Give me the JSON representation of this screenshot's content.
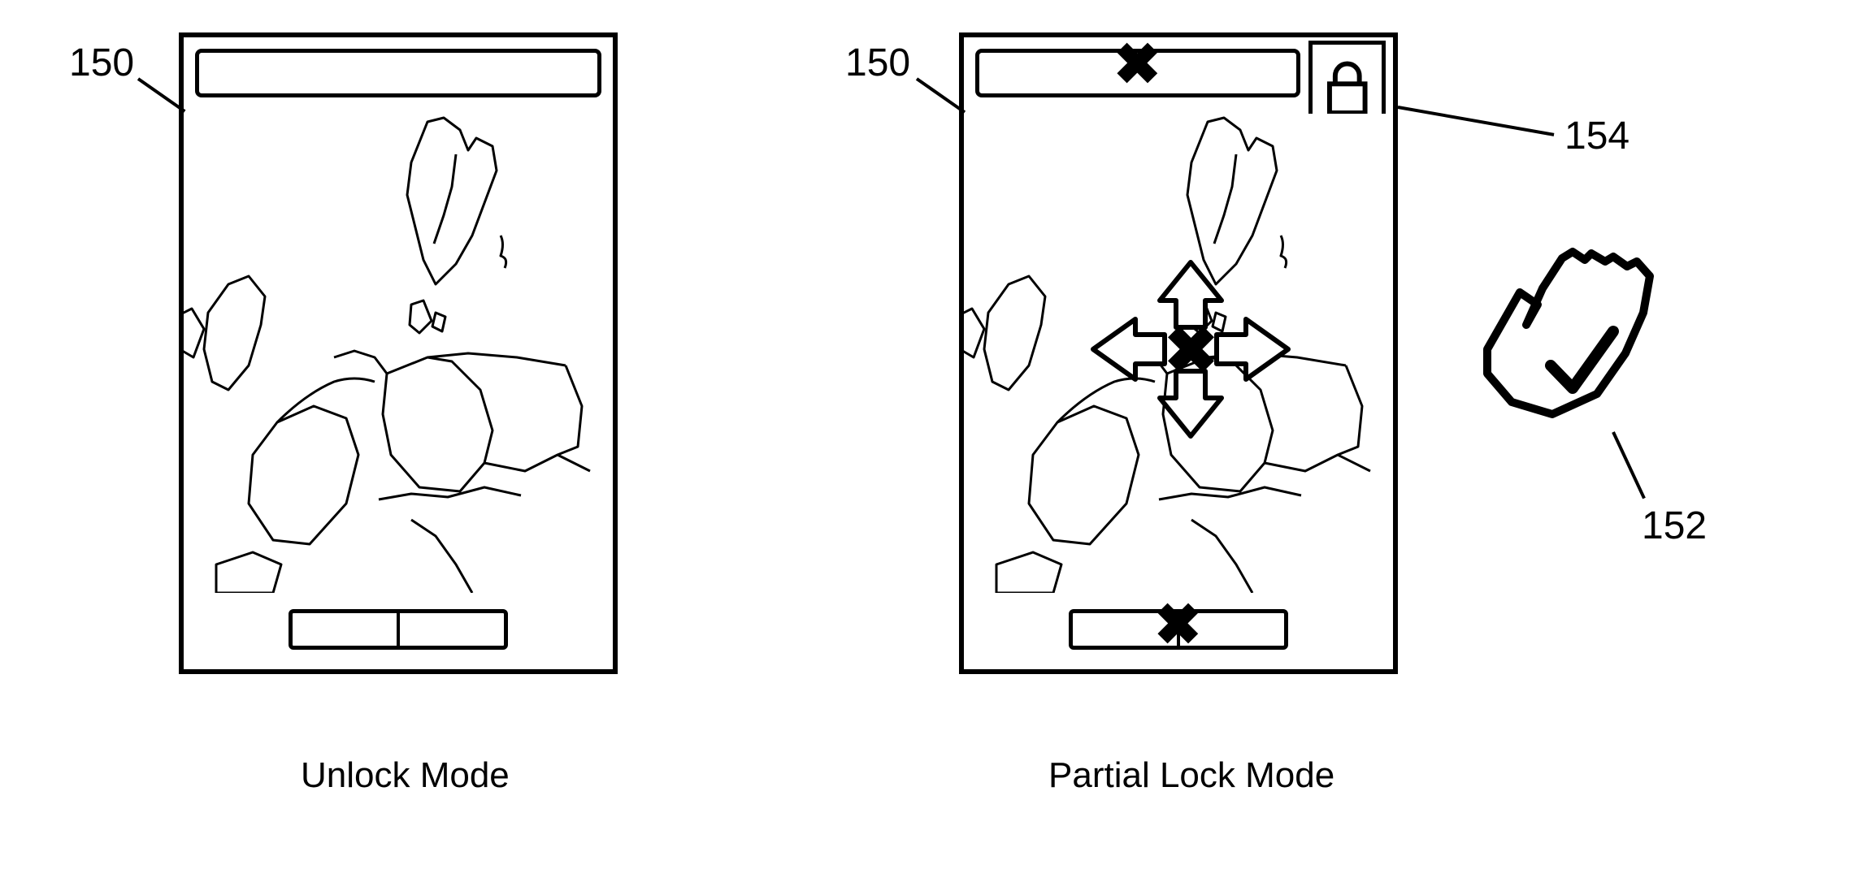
{
  "left": {
    "ref": "150",
    "caption": "Unlock Mode"
  },
  "right": {
    "ref": "150",
    "ref_lock": "154",
    "ref_hand": "152",
    "caption": "Partial Lock Mode"
  }
}
